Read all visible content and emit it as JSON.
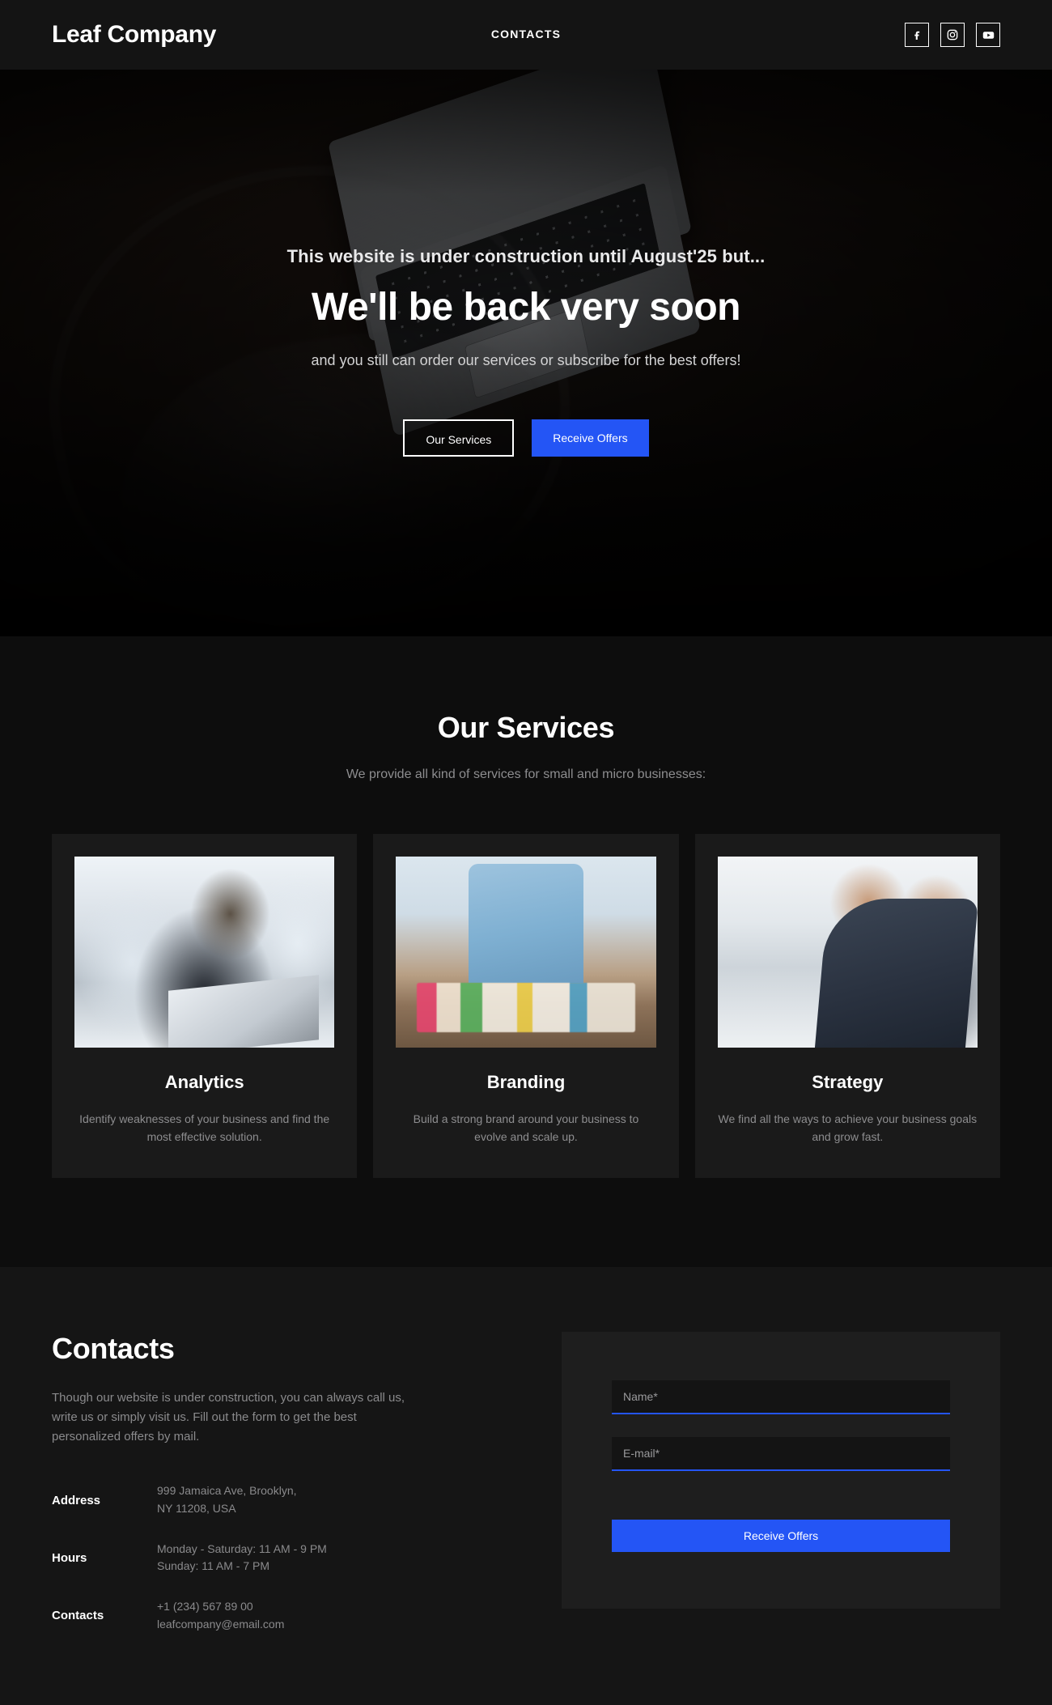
{
  "header": {
    "brand": "Leaf Company",
    "nav": [
      {
        "label": "CONTACTS"
      }
    ],
    "social": [
      {
        "name": "facebook",
        "label": "Facebook"
      },
      {
        "name": "instagram",
        "label": "Instagram"
      },
      {
        "name": "youtube",
        "label": "YouTube"
      }
    ]
  },
  "hero": {
    "eyebrow": "This website is under construction until August'25 but...",
    "title": "We'll be back very soon",
    "subtitle": "and you still can order our services or subscribe for the best offers!",
    "primary_button": "Receive Offers",
    "secondary_button": "Our Services"
  },
  "services": {
    "title": "Our Services",
    "subtitle": "We provide all kind of services for small and micro businesses:",
    "cards": [
      {
        "title": "Analytics",
        "text": "Identify weaknesses of your business and find the most effective solution.",
        "photo": "team-reviewing-laptop-photo"
      },
      {
        "title": "Branding",
        "text": "Build a strong brand around your business to evolve and scale up.",
        "photo": "desk-with-documents-photo"
      },
      {
        "title": "Strategy",
        "text": "We find all the ways to achieve your business goals and grow fast.",
        "photo": "businessmen-with-tablet-photo"
      }
    ]
  },
  "contacts": {
    "title": "Contacts",
    "description": "Though our website is under construction, you can always call us, write us or simply visit us. Fill out the form to get the best personalized offers by mail.",
    "rows": [
      {
        "label": "Address",
        "value": "999 Jamaica Ave, Brooklyn,\nNY 11208, USA"
      },
      {
        "label": "Hours",
        "value": "Monday - Saturday: 11 AM - 9 PM\nSunday: 11 AM - 7 PM"
      },
      {
        "label": "Contacts",
        "value": "+1 (234) 567 89 00\nleafcompany@email.com"
      }
    ],
    "form": {
      "name_placeholder": "Name*",
      "name_value": "",
      "email_placeholder": "E-mail*",
      "email_value": "",
      "submit_label": "Receive Offers"
    }
  },
  "colors": {
    "accent": "#2455f5",
    "page_bg": "#0d0d0d",
    "header_bg": "#141414",
    "card_bg": "#1a1a1a",
    "contacts_bg": "#151515",
    "panel_bg": "#1e1e1e",
    "text_primary": "#ffffff",
    "text_muted": "#8a8a8c"
  }
}
